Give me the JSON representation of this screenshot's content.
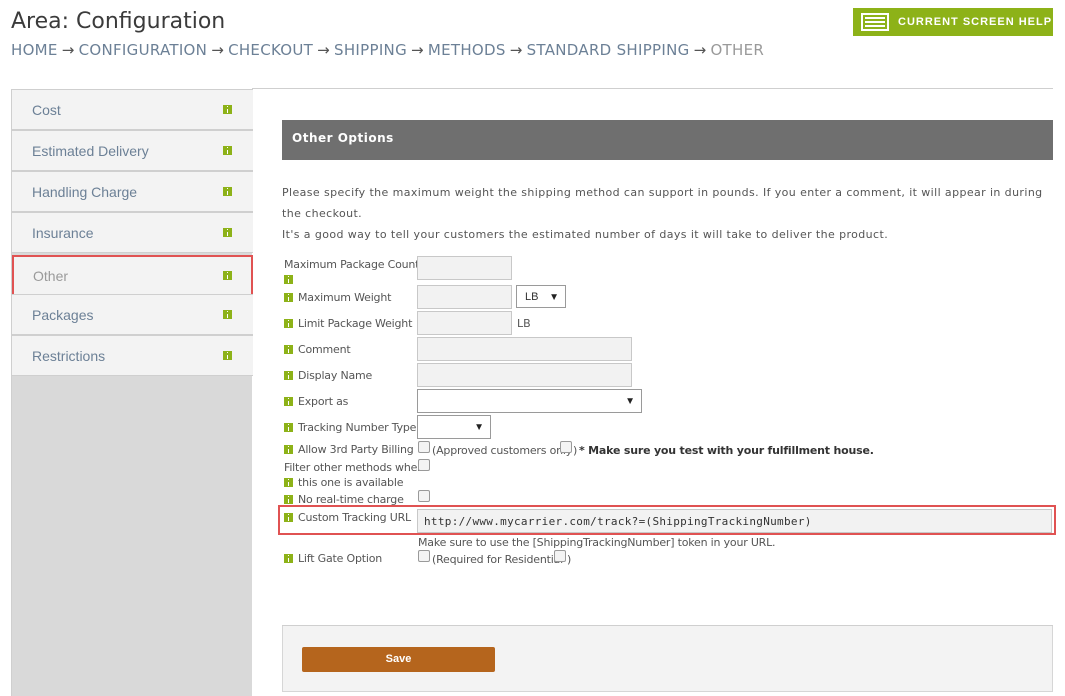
{
  "header": {
    "title": "Area: Configuration",
    "help_button": "CURRENT SCREEN HELP",
    "breadcrumb": {
      "arrow": "→",
      "items": [
        "HOME",
        "CONFIGURATION",
        "CHECKOUT",
        "SHIPPING",
        "METHODS",
        "STANDARD SHIPPING"
      ],
      "current": "OTHER"
    }
  },
  "sidebar": {
    "items": [
      {
        "label": "Cost"
      },
      {
        "label": "Estimated Delivery"
      },
      {
        "label": "Handling Charge"
      },
      {
        "label": "Insurance"
      },
      {
        "label": "Other",
        "active": true
      },
      {
        "label": "Packages"
      },
      {
        "label": "Restrictions"
      }
    ]
  },
  "panel": {
    "title": "Other Options",
    "description_1": "Please specify the maximum weight the shipping method can support in pounds. If you enter a comment, it will appear in during the checkout.",
    "description_2": "It's a good way to tell your customers the estimated number of days it will take to deliver the product."
  },
  "form": {
    "max_package_count": {
      "label": "Maximum Package Count",
      "value": ""
    },
    "max_weight": {
      "label": "Maximum Weight",
      "value": "",
      "unit_selected": "LB"
    },
    "limit_package_weight": {
      "label": "Limit Package Weight",
      "value": "",
      "unit": "LB"
    },
    "comment": {
      "label": "Comment",
      "value": ""
    },
    "display_name": {
      "label": "Display Name",
      "value": ""
    },
    "export_as": {
      "label": "Export as",
      "selected": ""
    },
    "tracking_number_type": {
      "label": "Tracking Number Type",
      "selected": ""
    },
    "allow_3rd_party_billing": {
      "label": "Allow 3rd Party Billing",
      "note_a": "(Approved customers only",
      "note_b": ")",
      "note_bold": "* Make sure you test with your fulfillment house."
    },
    "filter_other_methods": {
      "label_1": "Filter other methods when",
      "label_2": "this one is available"
    },
    "no_realtime_charge": {
      "label": "No real-time charge"
    },
    "custom_tracking_url": {
      "label": "Custom Tracking URL",
      "value": "http://www.mycarrier.com/track?=(ShippingTrackingNumber)",
      "hint": "Make sure to use the [ShippingTrackingNumber] token in your URL."
    },
    "lift_gate_option": {
      "label": "Lift Gate Option",
      "note_a": "(Required for Residential",
      "note_b": ")"
    }
  },
  "footer": {
    "save_label": "Save"
  },
  "colors": {
    "accent_green": "#8db218",
    "save_orange": "#b5651d",
    "highlight_red": "#e05252",
    "header_gray": "#6f6f6f"
  }
}
